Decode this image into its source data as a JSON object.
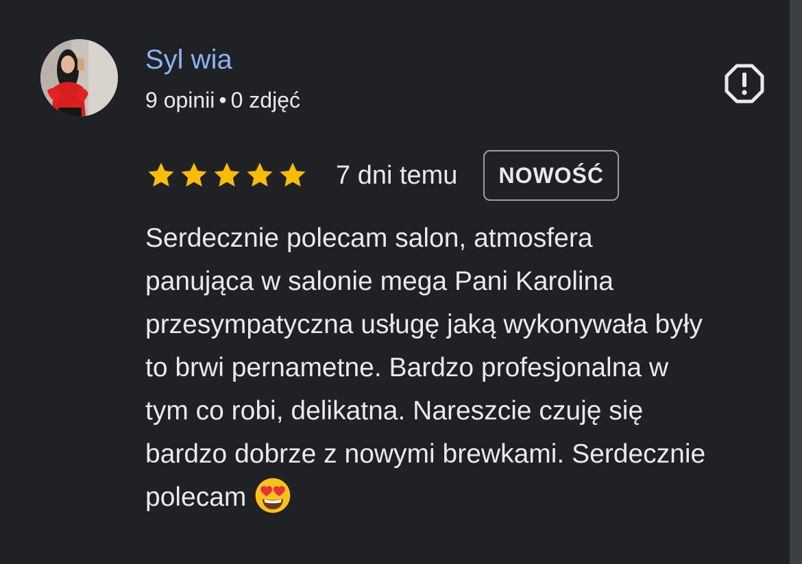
{
  "review": {
    "author": {
      "name": "Syl wia",
      "reviews_count_text": "9 opinii",
      "separator": "•",
      "photos_count_text": "0 zdjęć",
      "avatar_icon": "user-avatar-photo"
    },
    "report_icon": "alert-octagon-icon",
    "rating": {
      "stars": 5,
      "max_stars": 5,
      "star_color": "#fbbc04"
    },
    "date_text": "7 dni temu",
    "badge_text": "NOWOŚĆ",
    "text_lines": [
      "Serdecznie polecam salon, atmosfera",
      "panująca w salonie mega Pani Karolina",
      "przesympatyczna usługę jaką wykonywała były",
      "to brwi pernametne. Bardzo profesjonalna w",
      "tym co robi, delikatna. Nareszcie czuję się",
      "bardzo dobrze z nowymi brewkami. Serdecznie",
      "polecam"
    ],
    "emoji": "😍",
    "emoji_icon": "heart-eyes-emoji-icon"
  },
  "colors": {
    "background": "#202124",
    "author_name": "#8ab4f8",
    "text": "#e8eaed",
    "badge_border": "#9aa0a6",
    "edge": "#3c4043"
  }
}
